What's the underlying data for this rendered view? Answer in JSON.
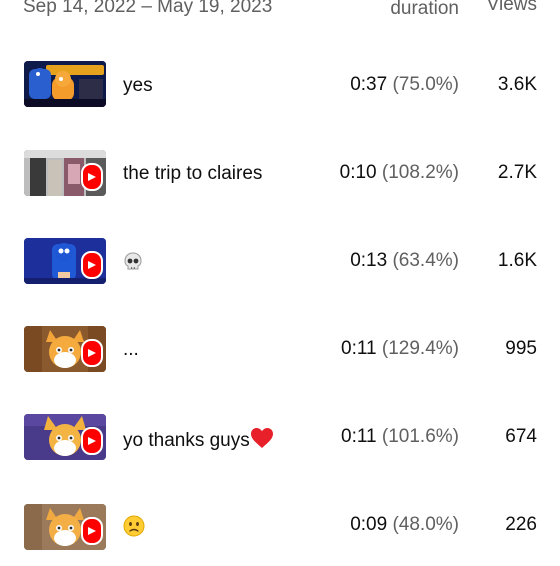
{
  "header": {
    "date_range": "Sep 14, 2022 – May 19, 2023",
    "col_duration": "duration",
    "col_views": "Views"
  },
  "colors": {
    "text": "#0f0f0f",
    "secondary": "#606060",
    "shorts_red": "#ff0000"
  },
  "rows": [
    {
      "title": "yes",
      "duration": "0:37",
      "percent": "(75.0%)",
      "views": "3.6K",
      "thumb": "sonic-tails-gif",
      "shorts": false
    },
    {
      "title": "the trip to claires",
      "duration": "0:10",
      "percent": "(108.2%)",
      "views": "2.7K",
      "thumb": "store-front",
      "shorts": true
    },
    {
      "title": "",
      "emoji": "skull-emoji",
      "duration": "0:13",
      "percent": "(63.4%)",
      "views": "1.6K",
      "thumb": "sonic-blue",
      "shorts": true
    },
    {
      "title": "...",
      "duration": "0:11",
      "percent": "(129.4%)",
      "views": "995",
      "thumb": "tails-brown",
      "shorts": true
    },
    {
      "title": "yo thanks guys",
      "emoji": "red-heart-emoji",
      "duration": "0:11",
      "percent": "(101.6%)",
      "views": "674",
      "thumb": "tails-purple",
      "shorts": true
    },
    {
      "title": "",
      "emoji": "slightly-frowning-face-emoji",
      "duration": "0:09",
      "percent": "(48.0%)",
      "views": "226",
      "thumb": "tails-tan",
      "shorts": true
    }
  ]
}
